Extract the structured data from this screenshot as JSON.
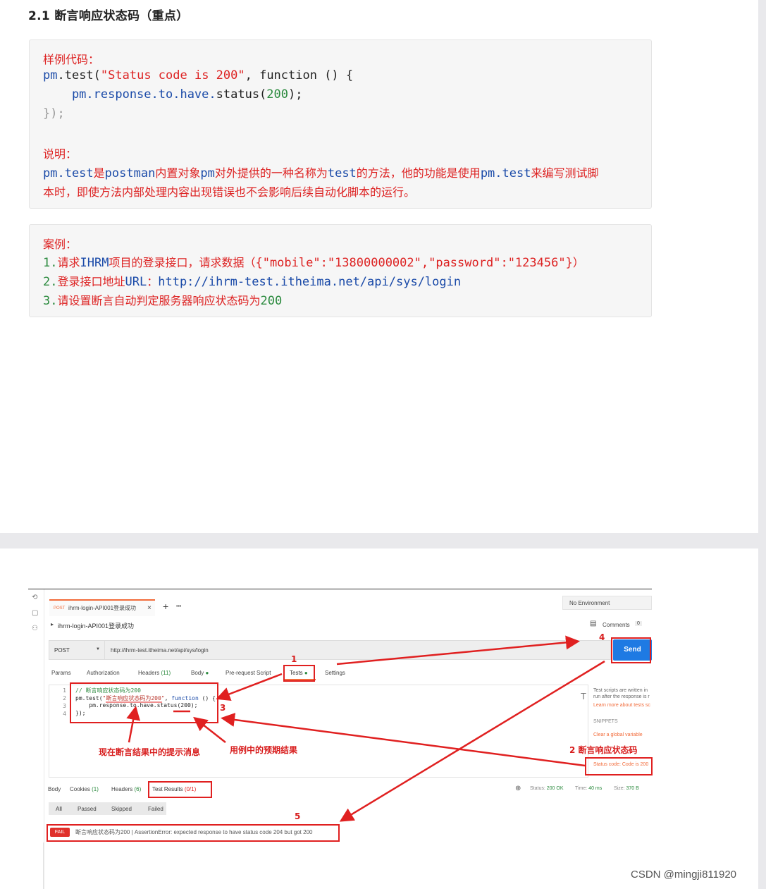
{
  "doc": {
    "heading": "2.1 断言响应状态码（重点）",
    "box1": {
      "sample_label": "样例代码：",
      "code1_a": "pm",
      "code1_b": ".test(",
      "code1_c": "\"Status code is 200\"",
      "code1_d": ", function () {",
      "code2_a": "    pm.response.to.have.",
      "code2_b": "status(",
      "code2_c": "200",
      "code2_d": ");",
      "code3": "});",
      "explain_label": "说明：",
      "explain_1a": "pm.test",
      "explain_1b": "是",
      "explain_1c": "postman",
      "explain_1d": "内置对象",
      "explain_1e": "pm",
      "explain_1f": "对外提供的一种名称为",
      "explain_1g": "test",
      "explain_1h": "的方法，他的功能是使用",
      "explain_1i": "pm.test",
      "explain_1j": "来编写测试脚",
      "explain_2": "本时，即使方法内部处理内容出现错误也不会影响后续自动化脚本的运行。"
    },
    "box2": {
      "case_label": "案例：",
      "l1_num": "1.",
      "l1_a": "请求",
      "l1_b": "IHRM",
      "l1_c": "项目的登录接口，请求数据（",
      "l1_d": "{\"mobile\":\"13800000002\",\"password\":\"123456\"}",
      "l1_e": "）",
      "l2_num": "2.",
      "l2_a": "登录接口地址",
      "l2_b": "URL",
      "l2_c": "：",
      "l2_d": "http://ihrm-test.itheima.net/api/sys/login",
      "l3_num": "3.",
      "l3_a": "请设置断言自动判定服务器响应状态码为",
      "l3_b": "200"
    }
  },
  "postman": {
    "tab": {
      "method": "POST",
      "name": "ihrm-login-API001登录成功",
      "close": "×",
      "add": "+",
      "more": "•••"
    },
    "environment": "No Environment",
    "breadcrumb": "ihrm-login-API001登录成功",
    "comments": "Comments",
    "comments_count": "0",
    "method": "POST",
    "url": "http://ihrm-test.itheima.net/api/sys/login",
    "send": "Send",
    "req_tabs": {
      "params": "Params",
      "auth": "Authorization",
      "headers": "Headers",
      "headers_count": "(11)",
      "body": "Body",
      "prereq": "Pre-request Script",
      "tests": "Tests",
      "settings": "Settings"
    },
    "code_lines": {
      "n1": "1",
      "n2": "2",
      "n3": "3",
      "n4": "4",
      "l1": "// 断言响应状态码为200",
      "l2a": "pm.test(",
      "l2b": "\"断言响应状态码为200\"",
      "l2c": ", ",
      "l2d": "function",
      "l2e": " () {",
      "l3": "    pm.response.to.have.status(200);",
      "l4": "});"
    },
    "side": {
      "desc1": "Test scripts are written in",
      "desc2": "run after the response is r",
      "learn": "Learn more about tests sc",
      "snippets": "SNIPPETS",
      "snip1": "Clear a global variable",
      "snip2": "Status code: Code is 200"
    },
    "resp_tabs": {
      "body": "Body",
      "cookies": "Cookies",
      "cookies_count": "(1)",
      "headers": "Headers",
      "headers_count": "(6)",
      "tests": "Test Results",
      "tests_count": "(0/1)"
    },
    "status": {
      "status_label": "Status:",
      "status_val": "200 OK",
      "time_label": "Time:",
      "time_val": "40 ms",
      "size_label": "Size:",
      "size_val": "370 B"
    },
    "filters": {
      "all": "All",
      "passed": "Passed",
      "skipped": "Skipped",
      "failed": "Failed"
    },
    "result": {
      "badge": "FAIL",
      "text": "断言响应状态码为200 | AssertionError: expected response to have status code 204 but got 200"
    }
  },
  "annotations": {
    "n1": "1",
    "n2": "2 断言响应状态码",
    "n3": "3",
    "n4": "4",
    "n5": "5",
    "msg_hint": "现在断言结果中的提示消息",
    "msg_expect": "用例中的预期结果"
  },
  "colors": {
    "annotation_red": "#e02020",
    "send_blue": "#1e7ae3",
    "postman_orange": "#f26b3a",
    "green": "#2b8a3e"
  },
  "watermark": "CSDN @mingji811920"
}
